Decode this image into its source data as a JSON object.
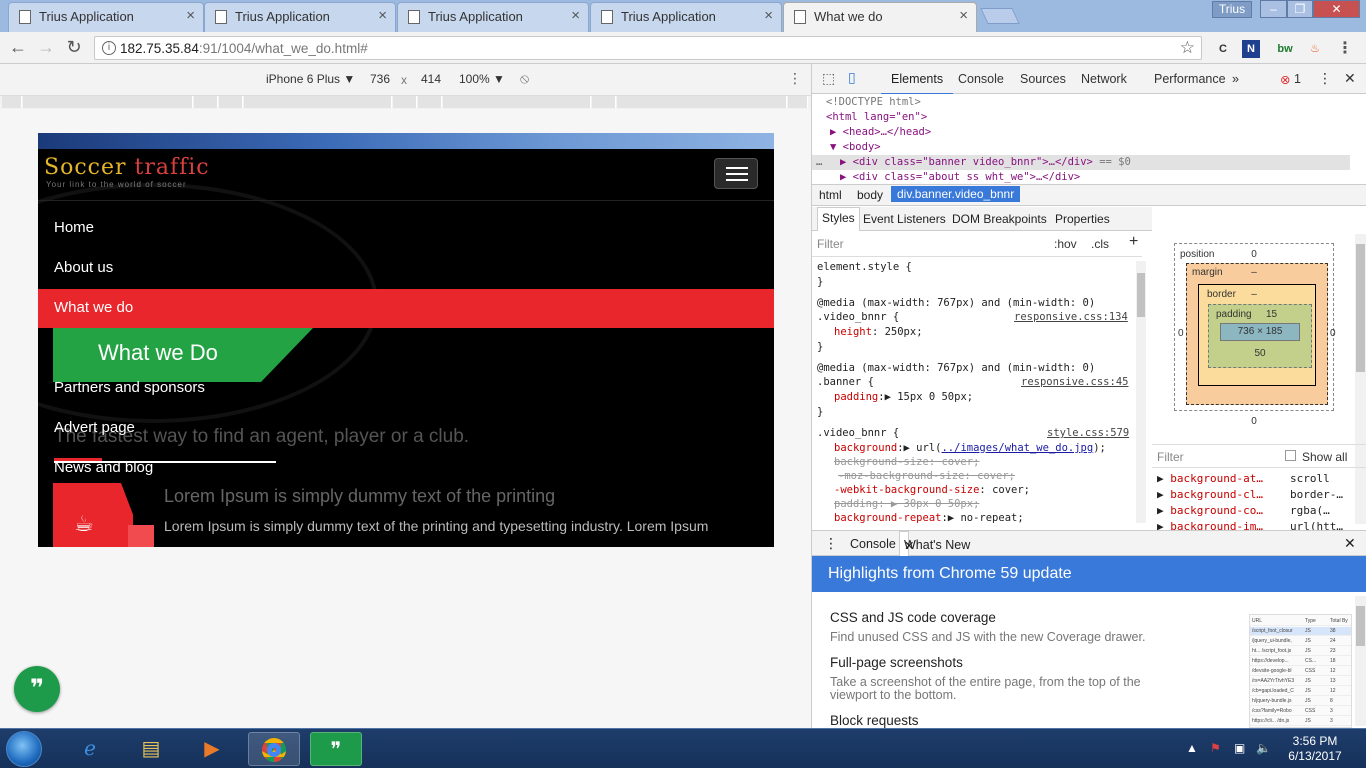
{
  "browser": {
    "tabs": [
      {
        "title": "Trius Application",
        "active": false
      },
      {
        "title": "Trius Application",
        "active": false
      },
      {
        "title": "Trius Application",
        "active": false
      },
      {
        "title": "Trius Application",
        "active": false
      },
      {
        "title": "What we do",
        "active": true
      }
    ],
    "user": "Trius",
    "url_host": "182.75.35.84",
    "url_path": ":91/1004/what_we_do.html#"
  },
  "device_toolbar": {
    "device": "iPhone 6 Plus",
    "width": "736",
    "times": "x",
    "height": "414",
    "zoom": "100%"
  },
  "site": {
    "logo_part1": "Soccer",
    "logo_part2": " traffic",
    "tagline": "Your link to the world of soccer",
    "nav": [
      "Home",
      "About us",
      "What we do",
      "Partners and sponsors",
      "Advert page",
      "News and blog"
    ],
    "active_nav": "What we do",
    "badge": "What we Do",
    "fastest": "The fastest way to find an agent, player or a club.",
    "lorem_heading": "Lorem Ipsum is simply dummy text of the printing",
    "lorem_body": "Lorem Ipsum is simply dummy text of the printing and typesetting industry. Lorem Ipsum"
  },
  "devtools": {
    "tabs": [
      "Elements",
      "Console",
      "Sources",
      "Network",
      "Performance"
    ],
    "error_count": "1",
    "dom": {
      "doctype": "<!DOCTYPE html>",
      "html_open": "<html lang=\"en\">",
      "head": "<head>…</head>",
      "body_open": "<body>",
      "sel_div": "<div class=\"banner video_bnnr\">…</div>",
      "sel_suffix": " == $0",
      "next_div": "<div class=\"about ss wht_we\">…</div>"
    },
    "breadcrumbs": [
      "html",
      "body",
      "div.banner.video_bnnr"
    ],
    "subtabs": [
      "Styles",
      "Event Listeners",
      "DOM Breakpoints",
      "Properties"
    ],
    "filter_placeholder": "Filter",
    "hov": ":hov",
    "cls": ".cls",
    "styles": {
      "element_style": "element.style {",
      "close": "}",
      "media1": "@media (max-width: 767px) and (min-width: 0)",
      "sel1": ".video_bnnr {",
      "src1": "responsive.css:134",
      "p1_name": "height",
      "p1_val": "250px;",
      "media2": "@media (max-width: 767px) and (min-width: 0)",
      "sel2": ".banner {",
      "src2": "responsive.css:45",
      "p2_name": "padding",
      "p2_val": "15px 0 50px;",
      "sel3": ".video_bnnr {",
      "src3": "style.css:579",
      "p3_name": "background",
      "p3_val_url": "../images/what_we_do.jpg",
      "p4": "background-size: cover;",
      "p5": "-moz-background-size: cover;",
      "p6_name": "-webkit-background-size",
      "p6_val": "cover;",
      "p7": "padding: ▶ 30px 0 50px;",
      "p8_name": "background-repeat",
      "p8_val": "no-repeat;"
    },
    "box_model": {
      "position_label": "position",
      "position_val": "0",
      "margin_label": "margin",
      "margin_val": "–",
      "border_label": "border",
      "border_val": "–",
      "padding_label": "padding",
      "padding_top": "15",
      "content": "736 × 185",
      "padding_bottom": "50",
      "side_left": "0",
      "side_right": "0",
      "dash": "-",
      "bottom": "0"
    },
    "computed_filter": "Filter",
    "show_all": "Show all",
    "computed": [
      {
        "name": "background-at…",
        "value": "scroll"
      },
      {
        "name": "background-cl…",
        "value": "border-…"
      },
      {
        "name": "background-co…",
        "value": "rgba(…"
      },
      {
        "name": "background-im…",
        "value": "url(htt…"
      }
    ],
    "drawer_tabs": [
      "Console",
      "What's New"
    ],
    "highlights": "Highlights from Chrome 59 update",
    "whats_new": [
      {
        "title": "CSS and JS code coverage",
        "desc": "Find unused CSS and JS with the new Coverage drawer."
      },
      {
        "title": "Full-page screenshots",
        "desc": "Take a screenshot of the entire page, from the top of the",
        "desc2": "viewport to the bottom."
      },
      {
        "title": "Block requests",
        "desc": ""
      }
    ],
    "thumb_rows": [
      [
        "URL",
        "Type",
        "Total By"
      ],
      [
        "/script_foot_closur",
        "JS",
        "38"
      ],
      [
        "/jquery_ui-bundle,",
        "JS",
        "24"
      ],
      [
        "ht... /script_foot.js",
        "JS",
        "23"
      ],
      [
        "https://develop...",
        "CS...",
        "18"
      ],
      [
        "/devsite-google-bl",
        "CSS",
        "12"
      ],
      [
        "/rs=AA2YrTtvhYE3",
        "JS",
        "13"
      ],
      [
        "/cb=gapi.loaded_C",
        "JS",
        "12"
      ],
      [
        "h/jquery-bundle.js",
        "JS",
        "8"
      ],
      [
        "/css?family=Robo",
        "CSS",
        "3"
      ],
      [
        "https://cli... /dn.js",
        "JS",
        "3"
      ]
    ]
  },
  "taskbar": {
    "time": "3:56 PM",
    "date": "6/13/2017"
  }
}
